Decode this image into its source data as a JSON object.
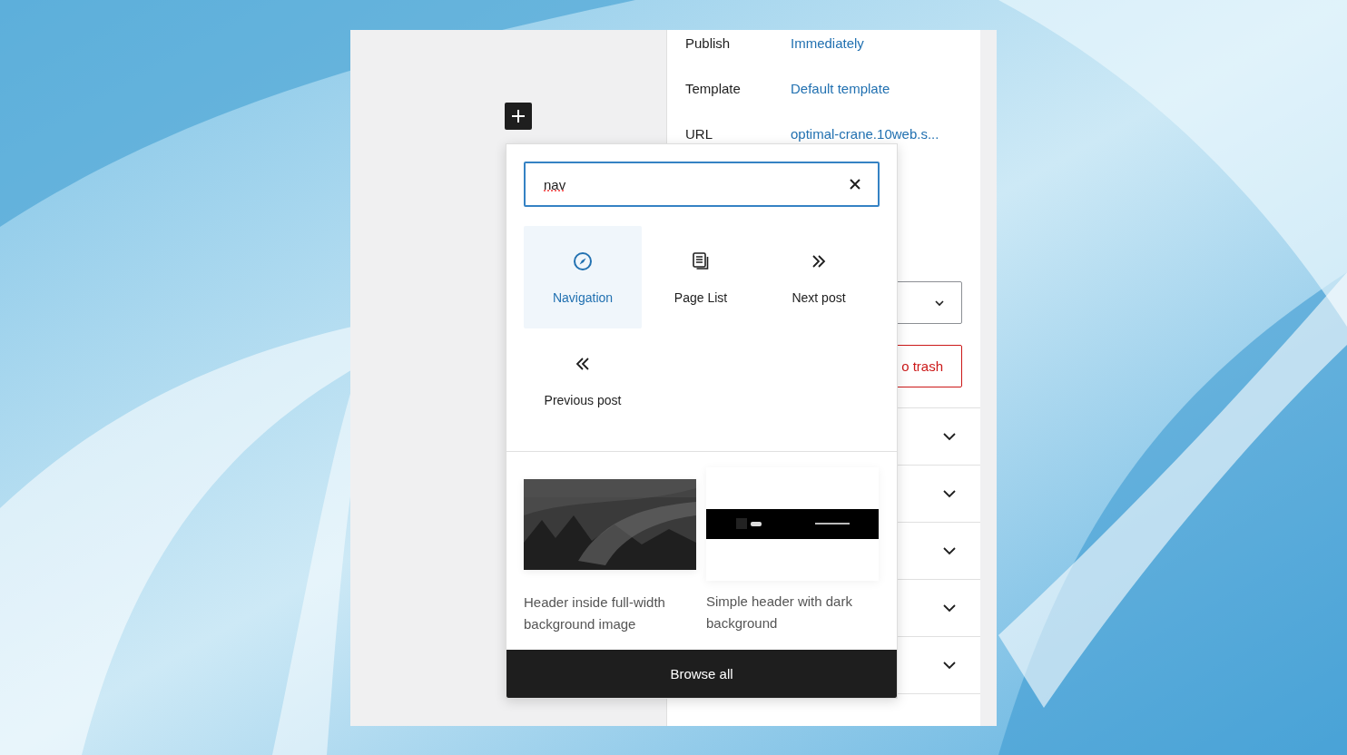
{
  "sidebar": {
    "rows": [
      {
        "label": "Publish",
        "value": "Immediately"
      },
      {
        "label": "Template",
        "value": "Default template"
      },
      {
        "label": "URL",
        "value": "optimal-crane.10web.s..."
      }
    ],
    "trash_button": {
      "label": "o trash"
    },
    "panels": [
      {
        "expanded": false
      },
      {
        "expanded": false
      },
      {
        "expanded": false
      },
      {
        "expanded": false
      },
      {
        "expanded": false
      }
    ]
  },
  "inserter": {
    "search": {
      "value": "nav"
    },
    "blocks": [
      {
        "label": "Navigation",
        "kind": "compass",
        "selected": true
      },
      {
        "label": "Page List",
        "kind": "pages",
        "selected": false
      },
      {
        "label": "Next post",
        "kind": "next",
        "selected": false
      },
      {
        "label": "Previous post",
        "kind": "previous",
        "selected": false
      }
    ],
    "patterns": [
      {
        "caption": "Header inside full-width background image"
      },
      {
        "caption": "Simple header with dark background",
        "kind": "banner"
      }
    ],
    "browse_button": {
      "label": "Browse all"
    }
  }
}
